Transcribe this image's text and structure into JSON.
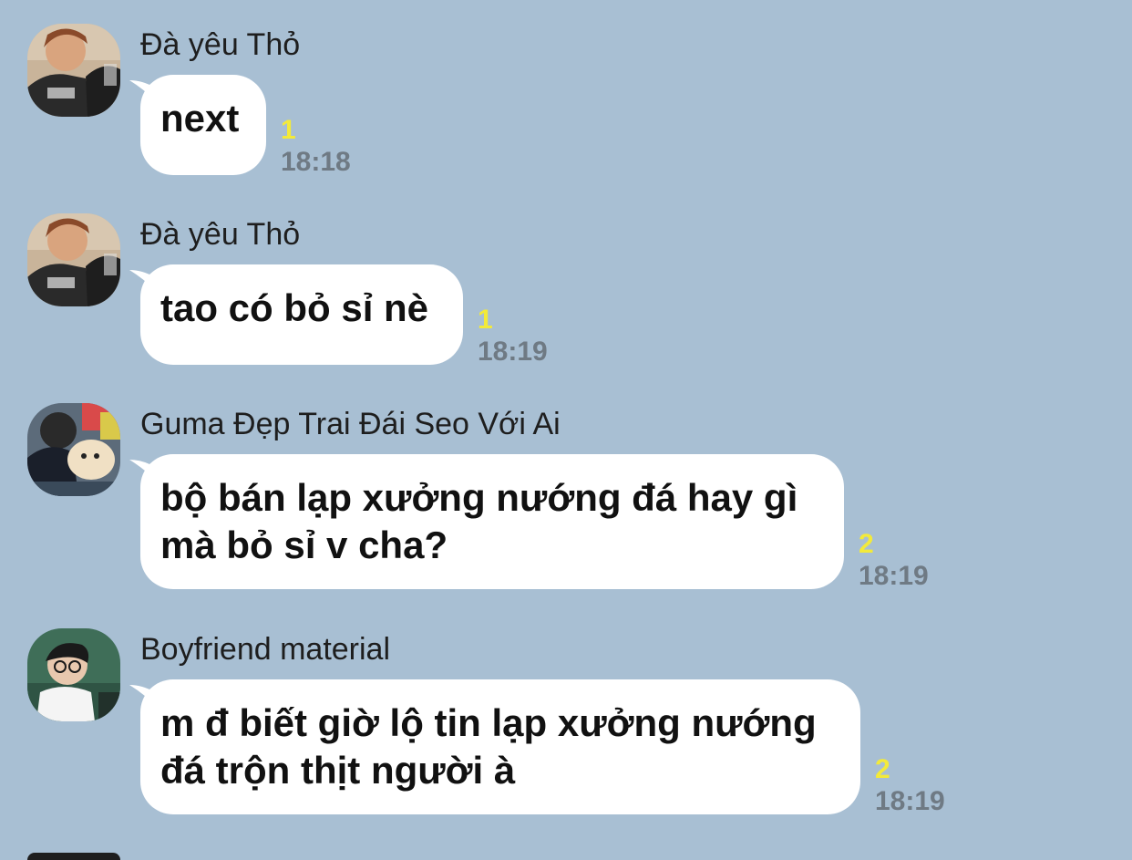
{
  "chat": {
    "messages": [
      {
        "sender": "Đà yêu Thỏ",
        "lines": [
          "next"
        ],
        "unread": "1",
        "time": "18:18"
      },
      {
        "sender": "Đà yêu Thỏ",
        "lines": [
          "tao có bỏ sỉ nè"
        ],
        "unread": "1",
        "time": "18:19"
      },
      {
        "sender": "Guma Đẹp Trai Đái Seo Với Ai",
        "lines": [
          "bộ bán lạp xưởng nướng đá hay gì",
          "mà bỏ sỉ v cha?"
        ],
        "unread": "2",
        "time": "18:19"
      },
      {
        "sender": "Boyfriend material",
        "lines": [
          "m đ biết giờ lộ tin lạp xưởng nướng",
          "đá trộn thịt người à"
        ],
        "unread": "2",
        "time": "18:19"
      }
    ]
  },
  "colors": {
    "background": "#a8bfd3",
    "bubble": "#ffffff",
    "unread": "#f3ea3a",
    "time": "#6f7a84"
  },
  "icons": [
    "avatar-photo-icon"
  ]
}
